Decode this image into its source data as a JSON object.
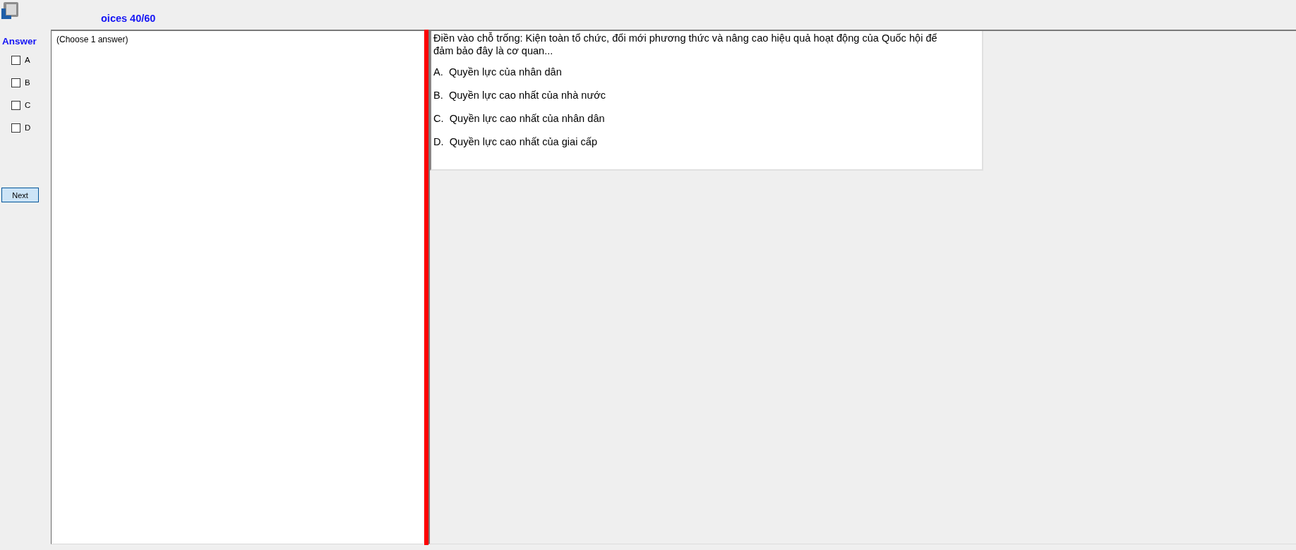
{
  "window": {
    "title": "oices 40/60"
  },
  "answer_panel": {
    "heading": "Answer",
    "options": [
      {
        "label": "A",
        "checked": false
      },
      {
        "label": "B",
        "checked": false
      },
      {
        "label": "C",
        "checked": false
      },
      {
        "label": "D",
        "checked": false
      }
    ],
    "next_button": "Next"
  },
  "instruction": "(Choose 1 answer)",
  "question": {
    "text": "Điền vào chỗ trống: Kiện toàn tổ chức, đổi mới phương thức và nâng cao hiệu quả hoạt động của Quốc hội để đảm bảo đây là cơ quan...",
    "choices": [
      "A.  Quyền lực của nhân dân",
      "B.  Quyền lực cao nhất của nhà nước",
      "C.  Quyền lực cao nhất của nhân dân",
      "D.  Quyền lực cao nhất của giai cấp"
    ]
  }
}
